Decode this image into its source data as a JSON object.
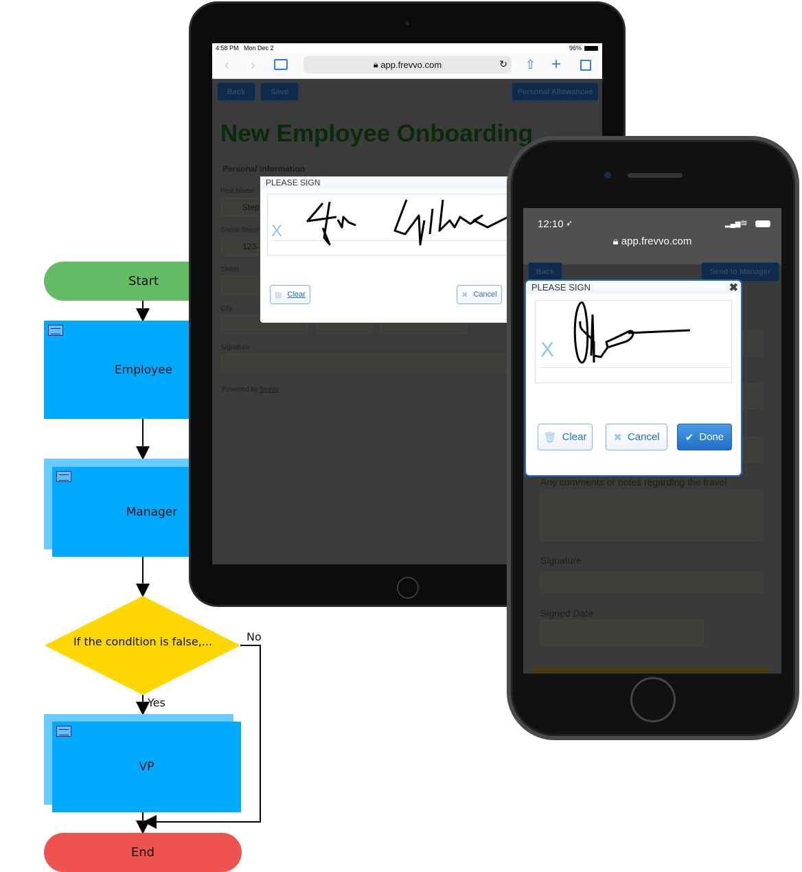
{
  "flowchart": {
    "start": "Start",
    "employee": "Employee",
    "manager": "Manager",
    "condition": "If the condition is false,...",
    "no": "No",
    "yes": "Yes",
    "vp": "VP",
    "end": "End",
    "colors": {
      "start": "#66bb66",
      "task": "#00aaff",
      "decision": "#ffd700",
      "end": "#ef5350"
    }
  },
  "tablet": {
    "status": {
      "time": "4:58 PM",
      "date": "Mon Dec 2",
      "battery": "96%"
    },
    "url": "app.frevvo.com",
    "buttons": {
      "back": "Back",
      "save": "Save",
      "next": "Personal Allowances"
    },
    "form_title": "New Employee Onboarding",
    "section": "Personal Information",
    "fields": {
      "first_name": "First Name",
      "first_name_value": "Step",
      "ssn": "Social Secur",
      "ssn_value": "123-",
      "street": "Street",
      "city": "City",
      "signature": "Signature"
    },
    "powered_by": "Powered by",
    "powered_link": "frevvo",
    "dialog": {
      "title": "PLEASE SIGN",
      "x_mark": "X",
      "clear": "Clear",
      "cancel": "Cancel"
    }
  },
  "phone": {
    "status": {
      "time": "12:10"
    },
    "url": "app.frevvo.com",
    "buttons": {
      "back": "Back",
      "next": "Send to Manager"
    },
    "dialog": {
      "title": "PLEASE SIGN",
      "x_mark": "X",
      "clear": "Clear",
      "cancel": "Cancel",
      "done": "Done"
    },
    "fields": {
      "comments": "Any comments or notes regarding the travel",
      "signature": "Signature",
      "signed_date": "Signed Date"
    }
  }
}
